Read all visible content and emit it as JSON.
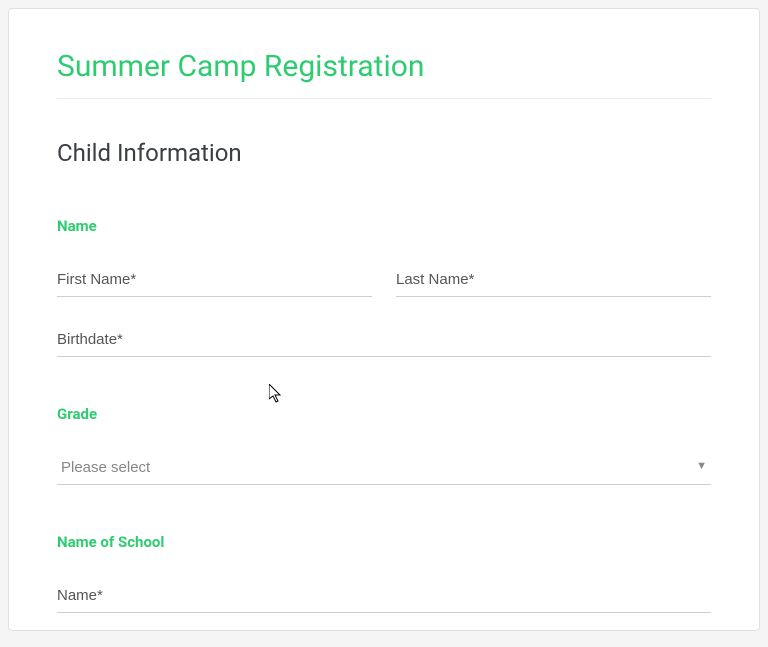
{
  "accent": "#2ecc71",
  "page": {
    "title": "Summer Camp Registration",
    "section_heading": "Child Information"
  },
  "groups": {
    "name": {
      "label": "Name",
      "first_name_placeholder": "First Name*",
      "last_name_placeholder": "Last Name*",
      "birthdate_placeholder": "Birthdate*"
    },
    "grade": {
      "label": "Grade",
      "select_placeholder": "Please select"
    },
    "school": {
      "label": "Name of School",
      "name_placeholder": "Name*"
    }
  }
}
